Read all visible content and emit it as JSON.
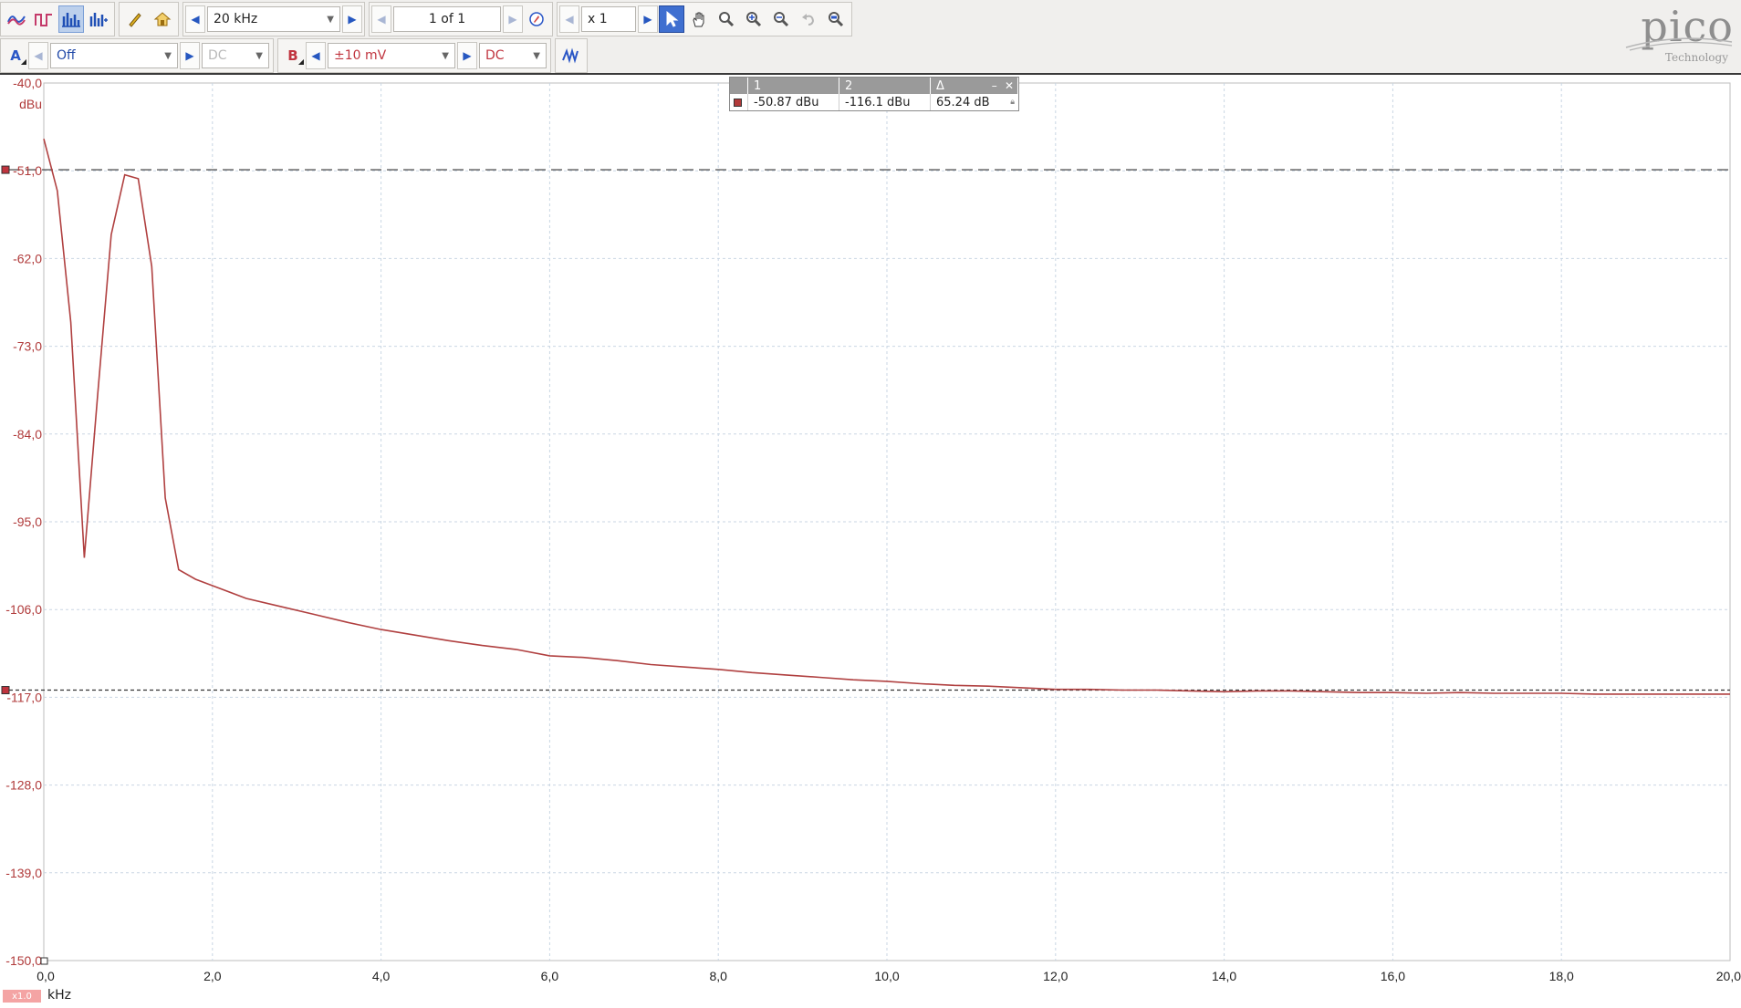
{
  "toolbar": {
    "timebase": "20 kHz",
    "page_indicator": "1 of 1",
    "zoom_factor": "x 1"
  },
  "channel_a": {
    "label": "A",
    "range": "Off",
    "coupling": "DC"
  },
  "channel_b": {
    "label": "B",
    "range": "±10 mV",
    "coupling": "DC"
  },
  "logo": {
    "word": "pico",
    "sub": "Technology"
  },
  "measurements": {
    "headers": [
      "1",
      "2",
      "Δ"
    ],
    "values": [
      "-50.87 dBu",
      "-116.1 dBu",
      "65.24 dB"
    ]
  },
  "x_axis": {
    "unit": "kHz",
    "scale_badge": "x1.0"
  },
  "chart_data": {
    "type": "line",
    "ylabel": "dBu",
    "xlabel": "kHz",
    "ylim": [
      -150,
      -40
    ],
    "xlim": [
      0,
      20
    ],
    "y_ticks": [
      "-40,0",
      "-51,0",
      "-62,0",
      "-73,0",
      "-84,0",
      "-95,0",
      "-106,0",
      "-117,0",
      "-128,0",
      "-139,0",
      "-150,0"
    ],
    "x_ticks": [
      "0,0",
      "2,0",
      "4,0",
      "6,0",
      "8,0",
      "10,0",
      "12,0",
      "14,0",
      "16,0",
      "18,0",
      "20,0"
    ],
    "grid": true,
    "line_color": "#b04040",
    "rulers": [
      {
        "value": -50.87,
        "style": "long-dash"
      },
      {
        "value": -116.1,
        "style": "short-dash"
      }
    ],
    "series": [
      {
        "x": [
          0.0,
          0.16,
          0.32,
          0.48,
          0.64,
          0.8,
          0.96,
          1.12,
          1.28,
          1.44,
          1.6,
          1.8,
          2.0,
          2.4,
          2.8,
          3.2,
          3.6,
          4.0,
          4.4,
          4.8,
          5.2,
          5.6,
          6.0,
          6.4,
          6.8,
          7.2,
          7.6,
          8.0,
          8.4,
          8.8,
          9.2,
          9.6,
          10.0,
          10.4,
          10.8,
          11.2,
          11.6,
          12.0,
          12.4,
          12.8,
          13.2,
          13.6,
          14.0,
          14.4,
          14.8,
          15.2,
          15.6,
          16.0,
          16.4,
          16.8,
          17.2,
          17.6,
          18.0,
          18.4,
          18.8,
          19.2,
          19.6,
          20.0
        ],
        "y": [
          -47.0,
          -53.5,
          -70.0,
          -99.5,
          -79.0,
          -59.0,
          -51.5,
          -52.0,
          -63.0,
          -92.0,
          -101.0,
          -102.2,
          -103.0,
          -104.6,
          -105.6,
          -106.6,
          -107.6,
          -108.5,
          -109.2,
          -109.9,
          -110.5,
          -111.0,
          -111.8,
          -112.0,
          -112.4,
          -112.9,
          -113.2,
          -113.5,
          -113.9,
          -114.2,
          -114.5,
          -114.8,
          -115.0,
          -115.3,
          -115.5,
          -115.6,
          -115.8,
          -116.0,
          -116.0,
          -116.1,
          -116.1,
          -116.2,
          -116.3,
          -116.2,
          -116.2,
          -116.3,
          -116.4,
          -116.4,
          -116.5,
          -116.4,
          -116.5,
          -116.5,
          -116.5,
          -116.6,
          -116.6,
          -116.6,
          -116.6,
          -116.6
        ]
      }
    ]
  }
}
